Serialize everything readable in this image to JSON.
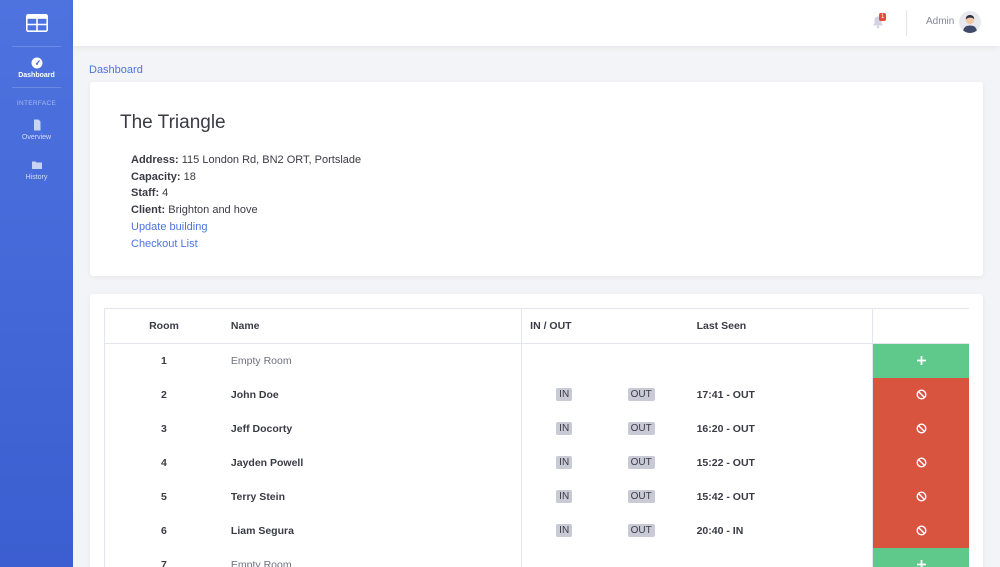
{
  "sidebar": {
    "items": [
      {
        "label": "Dashboard",
        "icon": "dashboard-icon",
        "active": true
      },
      {
        "label": "Overview",
        "icon": "file-icon"
      },
      {
        "label": "History",
        "icon": "folder-icon"
      }
    ],
    "section_heading": "INTERFACE"
  },
  "topbar": {
    "notification_count": "1",
    "user_name": "Admin"
  },
  "breadcrumb": "Dashboard",
  "building": {
    "name": "The Triangle",
    "address_label": "Address:",
    "address": "115 London Rd, BN2 ORT, Portslade",
    "capacity_label": "Capacity:",
    "capacity": "18",
    "staff_label": "Staff:",
    "staff": "4",
    "client_label": "Client:",
    "client": "Brighton and hove",
    "update_link": "Update building",
    "checkout_link": "Checkout List"
  },
  "table": {
    "headers": {
      "room": "Room",
      "name": "Name",
      "inout": "IN / OUT",
      "last_seen": "Last Seen"
    },
    "in_label": "IN",
    "out_label": "OUT",
    "rows": [
      {
        "room": "1",
        "name": "Empty Room",
        "last_seen": ""
      },
      {
        "room": "2",
        "name": "John Doe",
        "last_seen": "17:41 - OUT"
      },
      {
        "room": "3",
        "name": "Jeff Docorty",
        "last_seen": "16:20 - OUT"
      },
      {
        "room": "4",
        "name": "Jayden Powell",
        "last_seen": "15:22 - OUT"
      },
      {
        "room": "5",
        "name": "Terry Stein",
        "last_seen": "15:42 - OUT"
      },
      {
        "room": "6",
        "name": "Liam Segura",
        "last_seen": "20:40 - IN"
      },
      {
        "room": "7",
        "name": "Empty Room",
        "last_seen": ""
      }
    ]
  },
  "colors": {
    "sidebar": "#4e73df",
    "add": "#5ec98a",
    "block": "#d9543f",
    "link": "#4e73df"
  }
}
